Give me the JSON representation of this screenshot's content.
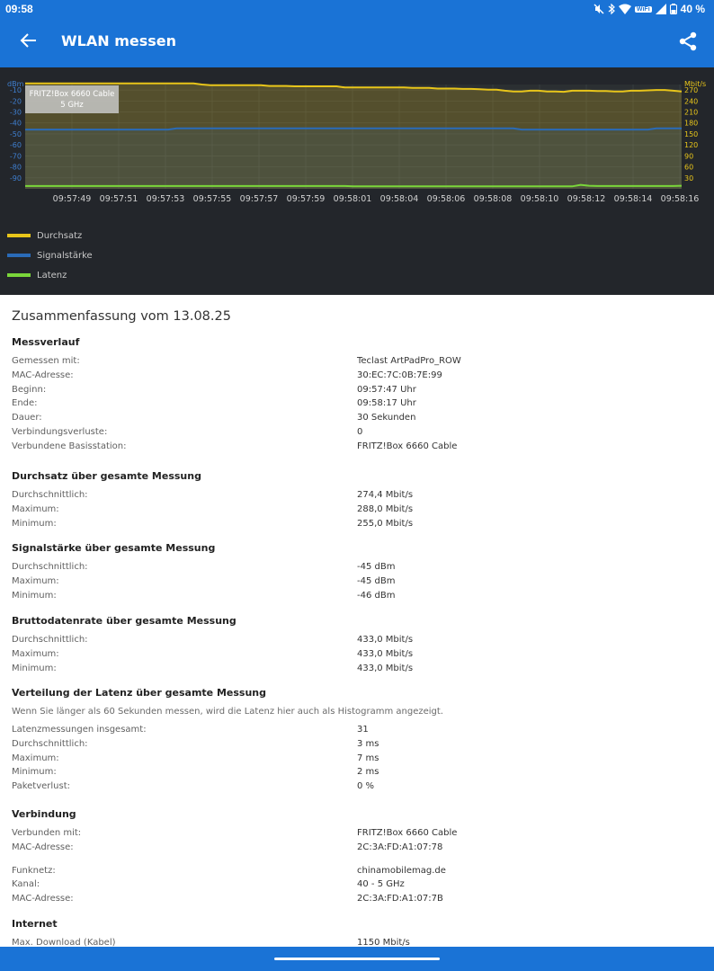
{
  "status_bar": {
    "time": "09:58",
    "battery": "40 %",
    "wifi_badge": "WiFi"
  },
  "app_bar": {
    "title": "WLAN messen"
  },
  "chart_data": [
    {
      "type": "line",
      "x_ticks": [
        "09:57:49",
        "09:57:51",
        "09:57:53",
        "09:57:55",
        "09:57:57",
        "09:57:59",
        "09:58:01",
        "09:58:04",
        "09:58:06",
        "09:58:08",
        "09:58:10",
        "09:58:12",
        "09:58:14",
        "09:58:16"
      ],
      "left_axis": {
        "unit": "dBm",
        "ticks": [
          -10,
          -20,
          -30,
          -40,
          -50,
          -60,
          -70,
          -80,
          -90
        ],
        "range": [
          -100,
          -5
        ]
      },
      "right_axis": {
        "unit": "Mbit/s",
        "ticks": [
          270,
          240,
          210,
          180,
          150,
          120,
          90,
          60,
          30
        ],
        "range": [
          0,
          285
        ]
      },
      "annotation": {
        "line1": "FRITZ!Box 6660 Cable",
        "line2": "5 GHz"
      },
      "series": [
        {
          "name": "Durchsatz",
          "color": "#e8c51a",
          "axis": "right",
          "values": [
            288,
            288,
            288,
            288,
            288,
            288,
            288,
            288,
            288,
            288,
            288,
            288,
            288,
            288,
            288,
            288,
            288,
            288,
            288,
            288,
            288,
            285,
            283,
            283,
            283,
            283,
            283,
            283,
            283,
            281,
            281,
            281,
            280,
            280,
            280,
            280,
            280,
            280,
            277,
            277,
            277,
            277,
            277,
            277,
            277,
            277,
            276,
            276,
            276,
            274,
            274,
            274,
            273,
            273,
            272,
            271,
            271,
            268,
            266,
            266,
            268,
            268,
            266,
            266,
            265,
            268,
            268,
            268,
            267,
            267,
            266,
            266,
            268,
            268,
            269,
            270,
            270,
            268,
            266
          ]
        },
        {
          "name": "Signalstärke",
          "color": "#2a6bb8",
          "axis": "left",
          "values": [
            -46,
            -46,
            -46,
            -46,
            -46,
            -46,
            -46,
            -46,
            -46,
            -46,
            -46,
            -46,
            -46,
            -46,
            -46,
            -46,
            -46,
            -46,
            -45,
            -45,
            -45,
            -45,
            -45,
            -45,
            -45,
            -45,
            -45,
            -45,
            -45,
            -45,
            -45,
            -45,
            -45,
            -45,
            -45,
            -45,
            -45,
            -45,
            -45,
            -45,
            -45,
            -45,
            -45,
            -45,
            -45,
            -45,
            -45,
            -45,
            -45,
            -45,
            -45,
            -45,
            -45,
            -45,
            -45,
            -45,
            -45,
            -45,
            -45,
            -46,
            -46,
            -46,
            -46,
            -46,
            -46,
            -46,
            -46,
            -46,
            -46,
            -46,
            -46,
            -46,
            -46,
            -46,
            -46,
            -45,
            -45,
            -45,
            -45
          ]
        },
        {
          "name": "Latenz",
          "color": "#7ad63a",
          "axis": "right",
          "unit": "ms",
          "values": [
            3,
            3,
            3,
            3,
            3,
            3,
            3,
            3,
            3,
            3,
            3,
            3,
            3,
            3,
            3,
            3,
            3,
            3,
            3,
            3,
            3,
            3,
            3,
            3,
            3,
            3,
            3,
            3,
            3,
            3,
            3,
            3,
            3,
            3,
            3,
            3,
            3,
            3,
            3,
            2,
            2,
            2,
            2,
            2,
            2,
            2,
            2,
            2,
            2,
            2,
            2,
            2,
            2,
            2,
            2,
            2,
            2,
            2,
            2,
            2,
            2,
            2,
            2,
            2,
            2,
            2,
            7,
            4,
            3,
            3,
            3,
            3,
            3,
            3,
            3,
            3,
            3,
            3,
            4
          ]
        }
      ]
    }
  ],
  "summary": {
    "title": "Zusammenfassung vom 13.08.25",
    "sections": [
      {
        "title": "Messverlauf",
        "rows": [
          {
            "k": "Gemessen mit:",
            "v": "Teclast ArtPadPro_ROW"
          },
          {
            "k": "MAC-Adresse:",
            "v": "30:EC:7C:0B:7E:99"
          },
          {
            "k": "Beginn:",
            "v": "09:57:47 Uhr"
          },
          {
            "k": "Ende:",
            "v": "09:58:17 Uhr"
          },
          {
            "k": "Dauer:",
            "v": "30 Sekunden"
          },
          {
            "k": "Verbindungsverluste:",
            "v": "0"
          },
          {
            "k": "Verbundene Basisstation:",
            "v": "FRITZ!Box 6660 Cable"
          }
        ]
      },
      {
        "title": "Durchsatz über gesamte Messung",
        "rows": [
          {
            "k": "Durchschnittlich:",
            "v": "274,4 Mbit/s"
          },
          {
            "k": "Maximum:",
            "v": "288,0 Mbit/s"
          },
          {
            "k": "Minimum:",
            "v": "255,0 Mbit/s"
          }
        ]
      },
      {
        "title": "Signalstärke über gesamte Messung",
        "rows": [
          {
            "k": "Durchschnittlich:",
            "v": "-45 dBm"
          },
          {
            "k": "Maximum:",
            "v": "-45 dBm"
          },
          {
            "k": "Minimum:",
            "v": "-46 dBm"
          }
        ]
      },
      {
        "title": "Bruttodatenrate über gesamte Messung",
        "rows": [
          {
            "k": "Durchschnittlich:",
            "v": "433,0 Mbit/s"
          },
          {
            "k": "Maximum:",
            "v": "433,0 Mbit/s"
          },
          {
            "k": "Minimum:",
            "v": "433,0 Mbit/s"
          }
        ]
      },
      {
        "title": "Verteilung der Latenz über gesamte Messung",
        "note": "Wenn Sie länger als 60 Sekunden messen, wird die Latenz hier auch als Histogramm angezeigt.",
        "rows": [
          {
            "k": "Latenzmessungen insgesamt:",
            "v": "31"
          },
          {
            "k": "Durchschnittlich:",
            "v": "3 ms"
          },
          {
            "k": "Maximum:",
            "v": "7 ms"
          },
          {
            "k": "Minimum:",
            "v": "2 ms"
          },
          {
            "k": "Paketverlust:",
            "v": "0 %"
          }
        ]
      },
      {
        "title": "Verbindung",
        "rows": [
          {
            "k": "Verbunden mit:",
            "v": "FRITZ!Box 6660 Cable"
          },
          {
            "k": "MAC-Adresse:",
            "v": "2C:3A:FD:A1:07:78"
          }
        ],
        "rows2": [
          {
            "k": "Funknetz:",
            "v": "chinamobilemag.de"
          },
          {
            "k": "Kanal:",
            "v": "40 - 5 GHz"
          },
          {
            "k": "MAC-Adresse:",
            "v": "2C:3A:FD:A1:07:7B"
          }
        ]
      },
      {
        "title": "Internet",
        "rows": [
          {
            "k": "Max. Download (Kabel)",
            "v": "1150 Mbit/s"
          }
        ]
      }
    ]
  }
}
